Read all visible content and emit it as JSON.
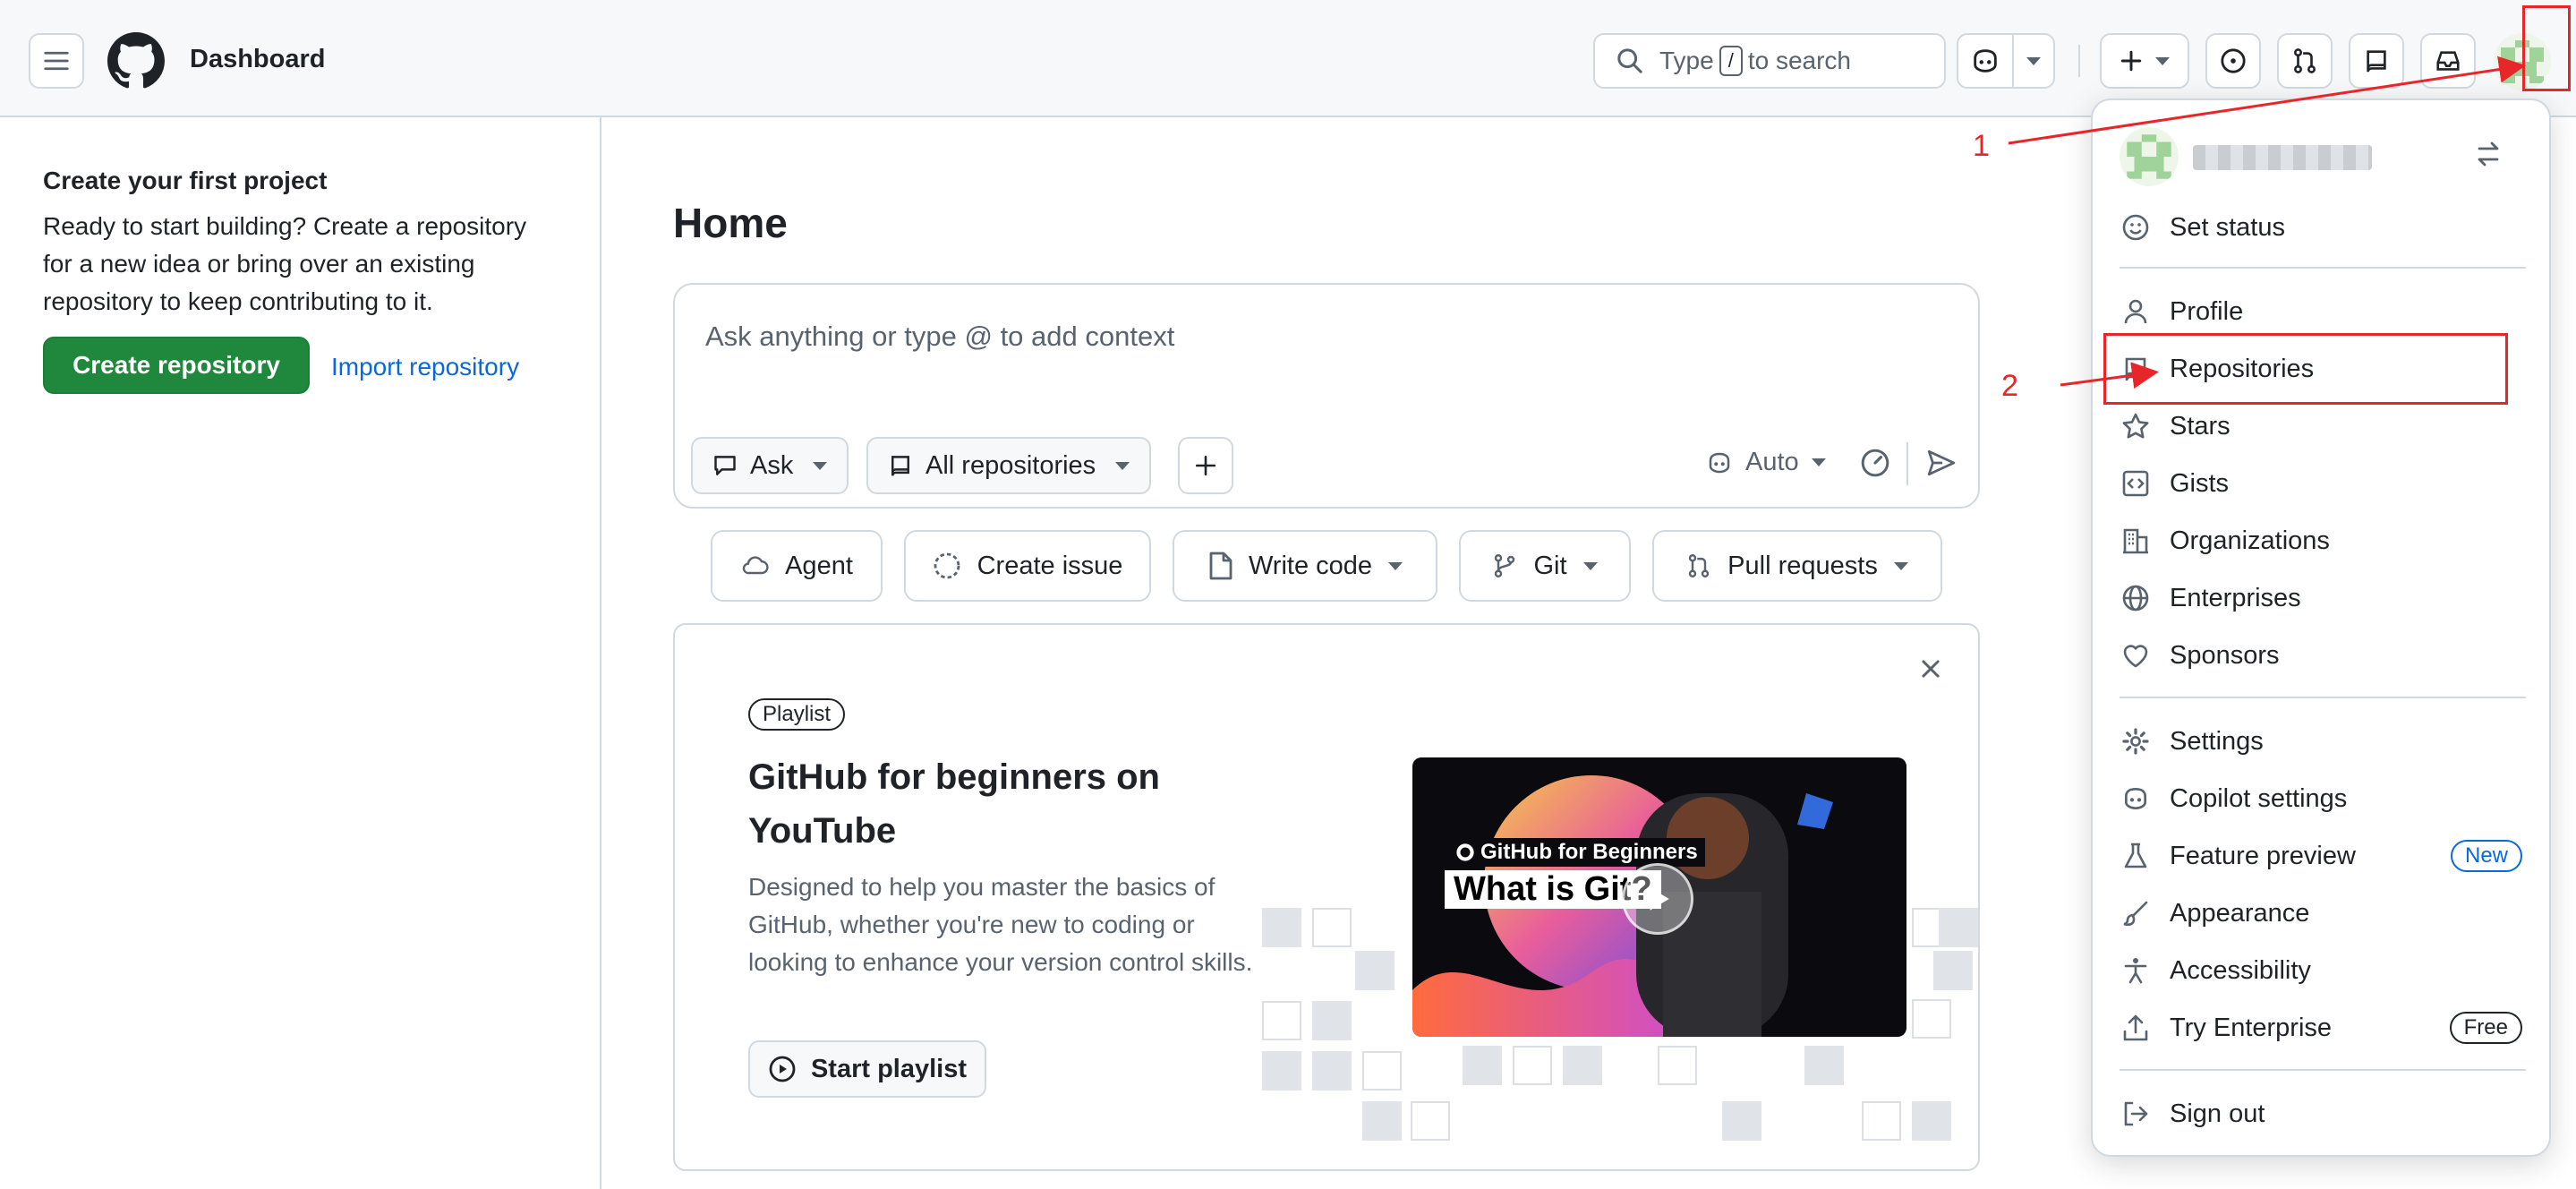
{
  "header": {
    "title": "Dashboard",
    "search_prefix": "Type",
    "search_key": "/",
    "search_suffix": "to search"
  },
  "sidebar": {
    "title": "Create your first project",
    "text": "Ready to start building? Create a repository for a new idea or bring over an existing repository to keep contributing to it.",
    "create_button": "Create repository",
    "import_link": "Import repository"
  },
  "main": {
    "title": "Home",
    "ask_placeholder": "Ask anything or type @ to add context",
    "ask_mode": "Ask",
    "repo_scope": "All repositories",
    "model": "Auto",
    "chips": [
      "Agent",
      "Create issue",
      "Write code",
      "Git",
      "Pull requests"
    ]
  },
  "card": {
    "badge": "Playlist",
    "title": "GitHub for beginners on YouTube",
    "text": "Designed to help you master the basics of GitHub, whether you're new to coding or looking to enhance your version control skills.",
    "button": "Start playlist",
    "video_brand": "GitHub for Beginners",
    "video_title": "What is Git?"
  },
  "menu": {
    "items": {
      "set_status": "Set status",
      "profile": "Profile",
      "repositories": "Repositories",
      "stars": "Stars",
      "gists": "Gists",
      "organizations": "Organizations",
      "enterprises": "Enterprises",
      "sponsors": "Sponsors",
      "settings": "Settings",
      "copilot_settings": "Copilot settings",
      "feature_preview": "Feature preview",
      "appearance": "Appearance",
      "accessibility": "Accessibility",
      "try_enterprise": "Try Enterprise",
      "sign_out": "Sign out"
    },
    "new_tag": "New",
    "free_tag": "Free"
  },
  "annotations": {
    "step1": "1",
    "step2": "2",
    "color": "#e8262a"
  }
}
